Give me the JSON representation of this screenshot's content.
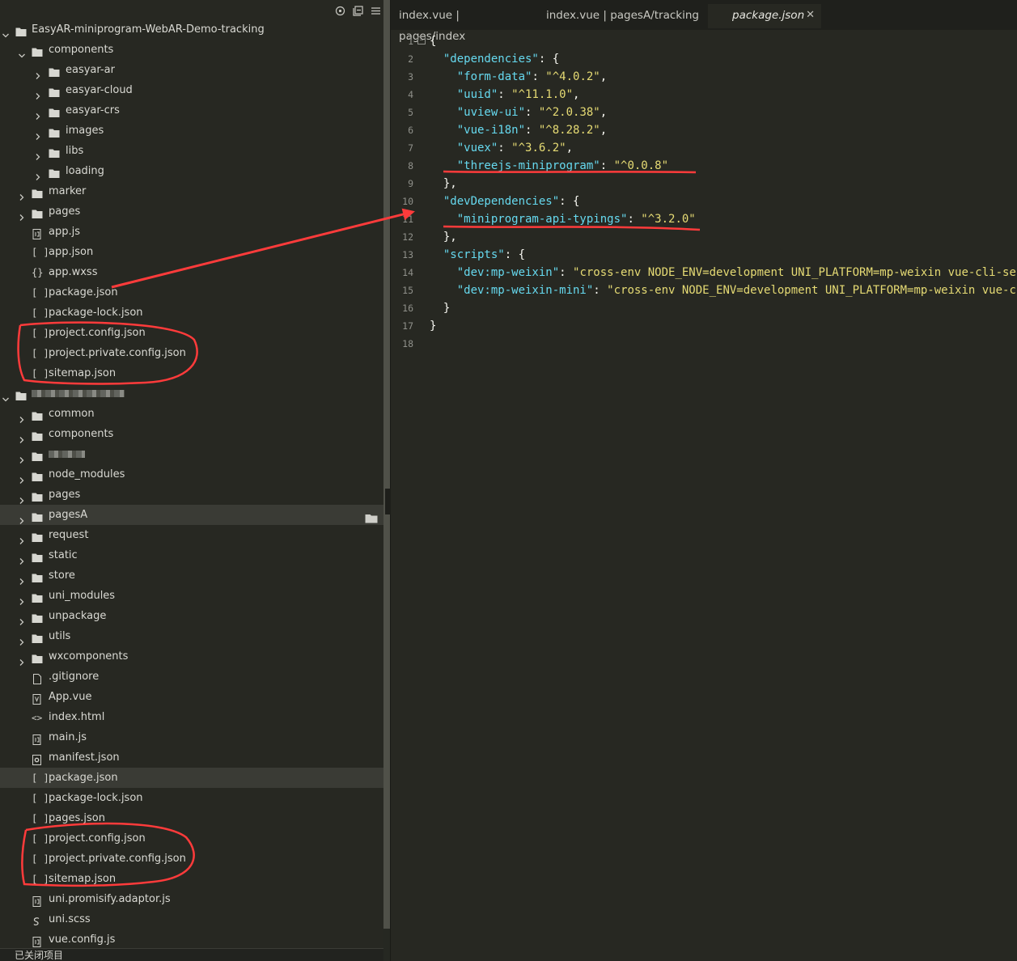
{
  "sidebar": {
    "toolbar": [
      "crosshair-icon",
      "collapse-all-icon",
      "menu-icon"
    ],
    "tree": [
      {
        "label": "EasyAR-miniprogram-WebAR-Demo-tracking",
        "type": "folder",
        "depth": 0,
        "expanded": true
      },
      {
        "label": "components",
        "type": "folder",
        "depth": 1,
        "expanded": true
      },
      {
        "label": "easyar-ar",
        "type": "folder",
        "depth": 2
      },
      {
        "label": "easyar-cloud",
        "type": "folder",
        "depth": 2
      },
      {
        "label": "easyar-crs",
        "type": "folder",
        "depth": 2
      },
      {
        "label": "images",
        "type": "folder",
        "depth": 2
      },
      {
        "label": "libs",
        "type": "folder",
        "depth": 2
      },
      {
        "label": "loading",
        "type": "folder",
        "depth": 2
      },
      {
        "label": "marker",
        "type": "folder",
        "depth": 1
      },
      {
        "label": "pages",
        "type": "folder",
        "depth": 1
      },
      {
        "label": "app.js",
        "type": "js",
        "depth": 1
      },
      {
        "label": "app.json",
        "type": "json",
        "depth": 1
      },
      {
        "label": "app.wxss",
        "type": "css",
        "depth": 1
      },
      {
        "label": "package.json",
        "type": "json",
        "depth": 1
      },
      {
        "label": "package-lock.json",
        "type": "json",
        "depth": 1
      },
      {
        "label": "project.config.json",
        "type": "json",
        "depth": 1
      },
      {
        "label": "project.private.config.json",
        "type": "json",
        "depth": 1
      },
      {
        "label": "sitemap.json",
        "type": "json",
        "depth": 1
      },
      {
        "label": "",
        "type": "folder-blurred",
        "depth": 0,
        "expanded": true
      },
      {
        "label": "common",
        "type": "folder",
        "depth": 1
      },
      {
        "label": "components",
        "type": "folder",
        "depth": 1
      },
      {
        "label": "",
        "type": "folder-blurred",
        "depth": 1
      },
      {
        "label": "node_modules",
        "type": "folder",
        "depth": 1
      },
      {
        "label": "pages",
        "type": "folder",
        "depth": 1
      },
      {
        "label": "pagesA",
        "type": "folder",
        "depth": 1,
        "hover": true
      },
      {
        "label": "request",
        "type": "folder",
        "depth": 1
      },
      {
        "label": "static",
        "type": "folder",
        "depth": 1
      },
      {
        "label": "store",
        "type": "folder",
        "depth": 1
      },
      {
        "label": "uni_modules",
        "type": "folder",
        "depth": 1
      },
      {
        "label": "unpackage",
        "type": "folder",
        "depth": 1
      },
      {
        "label": "utils",
        "type": "folder",
        "depth": 1
      },
      {
        "label": "wxcomponents",
        "type": "folder",
        "depth": 1
      },
      {
        "label": ".gitignore",
        "type": "file",
        "depth": 1
      },
      {
        "label": "App.vue",
        "type": "vue",
        "depth": 1
      },
      {
        "label": "index.html",
        "type": "html",
        "depth": 1
      },
      {
        "label": "main.js",
        "type": "js",
        "depth": 1
      },
      {
        "label": "manifest.json",
        "type": "manifest",
        "depth": 1
      },
      {
        "label": "package.json",
        "type": "json",
        "depth": 1,
        "selected": true
      },
      {
        "label": "package-lock.json",
        "type": "json",
        "depth": 1
      },
      {
        "label": "pages.json",
        "type": "json",
        "depth": 1
      },
      {
        "label": "project.config.json",
        "type": "json",
        "depth": 1
      },
      {
        "label": "project.private.config.json",
        "type": "json",
        "depth": 1
      },
      {
        "label": "sitemap.json",
        "type": "json",
        "depth": 1
      },
      {
        "label": "uni.promisify.adaptor.js",
        "type": "js",
        "depth": 1
      },
      {
        "label": "uni.scss",
        "type": "scss",
        "depth": 1
      },
      {
        "label": "vue.config.js",
        "type": "js",
        "depth": 1
      }
    ],
    "bottom_label": "已关闭项目"
  },
  "tabs": [
    {
      "label": "index.vue | pages/index",
      "active": false
    },
    {
      "label": "index.vue | pagesA/tracking",
      "active": false
    },
    {
      "label": "package.json",
      "active": true
    }
  ],
  "code": [
    "{",
    "  \"dependencies\": {",
    "    \"form-data\": \"^4.0.2\",",
    "    \"uuid\": \"^11.1.0\",",
    "    \"uview-ui\": \"^2.0.38\",",
    "    \"vue-i18n\": \"^8.28.2\",",
    "    \"vuex\": \"^3.6.2\",",
    "    \"threejs-miniprogram\": \"^0.0.8\"",
    "  },",
    "  \"devDependencies\": {",
    "    \"miniprogram-api-typings\": \"^3.2.0\"",
    "  },",
    "  \"scripts\": {",
    "    \"dev:mp-weixin\": \"cross-env NODE_ENV=development UNI_PLATFORM=mp-weixin vue-cli-service uni-build --watch\",",
    "    \"dev:mp-weixin-mini\": \"cross-env NODE_ENV=development UNI_PLATFORM=mp-weixin vue-cli-service uni-build --watch --minimize\"",
    "  }",
    "}",
    ""
  ],
  "colors": {
    "key": "#66d9ef",
    "string": "#e6db74",
    "annotation": "#ff3b3b"
  }
}
